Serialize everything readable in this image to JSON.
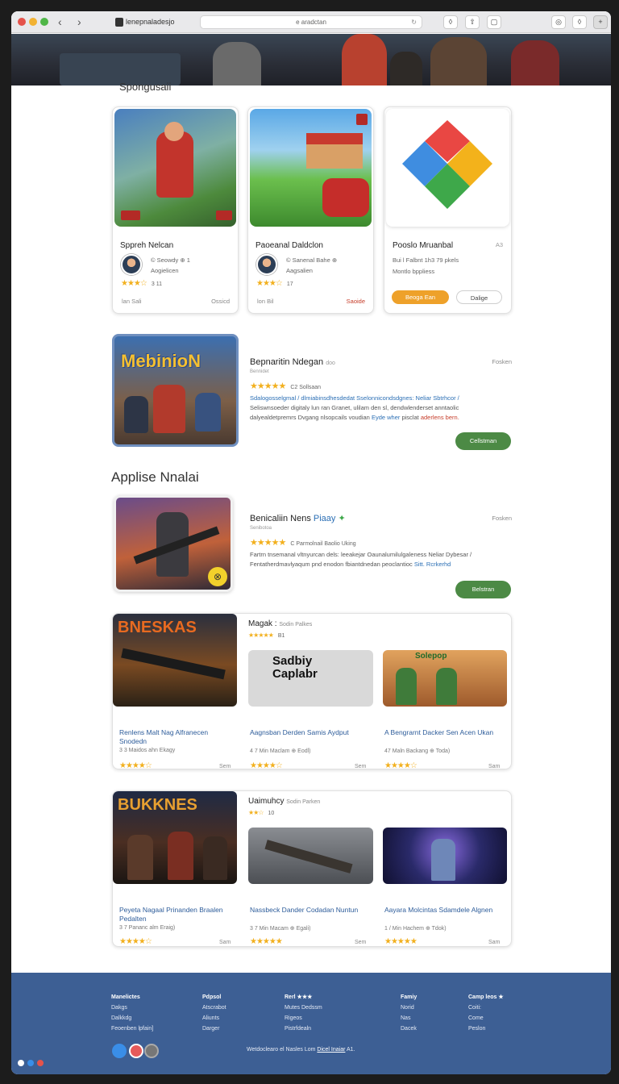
{
  "browser": {
    "tab_title": "lenepnaladesjo",
    "url": "e aradctan",
    "colors": {
      "close": "#e5534b",
      "minimize": "#f2b233",
      "zoom": "#4fb647"
    }
  },
  "page": {
    "section_top": "Spongusaii",
    "section_mid": "Applise Nnalai"
  },
  "top_cards": [
    {
      "title": "Sppreh Nelcan",
      "dev": "© Seowdy ⊕ 1",
      "dev2": "Aogielicen",
      "rating": "★★★☆",
      "score": "3 11",
      "meta_left": "lan Sali",
      "meta_right": "Ossicd"
    },
    {
      "title": "Paoeanal Daldclon",
      "dev": "© Sanenal Bahe ⊕",
      "dev2": "Aagsalien",
      "rating": "★★★☆",
      "score": "17",
      "meta_left": "lon Bil",
      "meta_right": "Saoide"
    },
    {
      "title": "Pooslo Mruanbal",
      "side": "A3",
      "line1": "Bui l Falbnt 1h3 79 pkels",
      "line2": "Montlo bppliess",
      "btn_primary": "Beoga Ean",
      "btn_secondary": "Dalige"
    }
  ],
  "featured": [
    {
      "title": "Bepnaritin Ndegan",
      "title_extra": "doo",
      "side": "Fosken",
      "sub": "Bennidet",
      "rating": "★★★★★",
      "rating_extra": "C2 Sollsaan",
      "desc1": "Sdalogosselgmal / dlmiabinsdhesdedat Sselonnicondsdgnes: Neliar Sbtrhcor /",
      "desc2": "Seliswnsoeder digitaly lun ran Granet, ulilam den sl, dendwlenderset anntaolic",
      "desc3": "dalyealdetpremrs Dvgang nlsopcails voudian",
      "desc3b": "Eyde wher",
      "desc3c": "pisclat",
      "desc3d": "aderlens bern.",
      "button": "Cellstman",
      "banner": "MebinioN"
    },
    {
      "title": "Benicaliin Nens",
      "title_extra": "Piaay",
      "side": "Fosken",
      "sub": "Senibotoa",
      "rating": "★★★★★",
      "rating_extra": "C Parmolnail Baolio Uking",
      "desc1": "Fartrn tnsemanal vltnyurcan dels: leeakejar Oaunalumilulgaleness Neliar Dybesar /",
      "desc2": "Fentatherdmavlyaqum pnd enodon fbiantdnedan peoclantioc",
      "desc2b": "Sitt. Rcrkerhd",
      "button": "Belstran"
    }
  ],
  "grids": [
    {
      "label": "Magak",
      "label_extra": "Sodin Palkes",
      "rating": "★★★★★",
      "score": "B1",
      "items": [
        {
          "art": "BNESKAS",
          "cap": "Renlens Malt Nag Alfranecen Snodedn",
          "sub": "3 3 Maidos ahn Ekagy",
          "rating": "★★★★☆",
          "tag": "Sem"
        },
        {
          "art": "Sadbiy Caplabr",
          "cap": "Aagnsban Derden Samis Aydput",
          "sub": "4 7 Min Maclam ⊕ Eodl)",
          "rating": "★★★★☆",
          "tag": "Sem"
        },
        {
          "art": "Solepop",
          "cap": "A Bengrarnt Dacker Sen Acen Ukan",
          "sub": "47 Maln Backang ⊕ Toda)",
          "rating": "★★★★☆",
          "tag": "Sam"
        }
      ]
    },
    {
      "label": "Uaimuhcy",
      "label_extra": "Sodin Parken",
      "rating": "★★☆",
      "score": "10",
      "items": [
        {
          "art": "BUKKNES",
          "cap": "Peyeta Nagaal Prinanden Braalen Pedalten",
          "sub": "3 7 Pananc alm Eraig)",
          "rating": "★★★★☆",
          "tag": "Sam"
        },
        {
          "art": "",
          "cap": "Nassbeck Dander Codadan Nuntun",
          "sub": "3 7 Min Macam ⊕ Egali)",
          "rating": "★★★★★",
          "tag": "Sem"
        },
        {
          "art": "",
          "cap": "Aayara Molcintas Sdamdele Algnen",
          "sub": "1 / Min Hachem ⊕ Tdok)",
          "rating": "★★★★★",
          "tag": "Sam"
        }
      ]
    }
  ],
  "footer": {
    "cols": [
      {
        "h": "Manelictes",
        "items": [
          "Dakgs",
          "Dalkkdg",
          "Feoenben lpfain]"
        ]
      },
      {
        "h": "Pdpsol",
        "items": [
          "Atscrabot",
          "Aliunts",
          "Darger"
        ]
      },
      {
        "h": "Rerl ★★★",
        "items": [
          "Mutes Dedssm",
          "Rigeos",
          "Pistrfdealn"
        ]
      },
      {
        "h": "Famiy",
        "items": [
          "Norid",
          "Nas",
          "Dacek"
        ]
      },
      {
        "h": "Camp leos ★",
        "items": [
          "Coiti:",
          "Come",
          "Peslon"
        ]
      }
    ],
    "bottom_text": "Wetdoclearo el Nasles Lom",
    "bottom_link": "Dicel Inaiar",
    "bottom_tail": "A1."
  }
}
